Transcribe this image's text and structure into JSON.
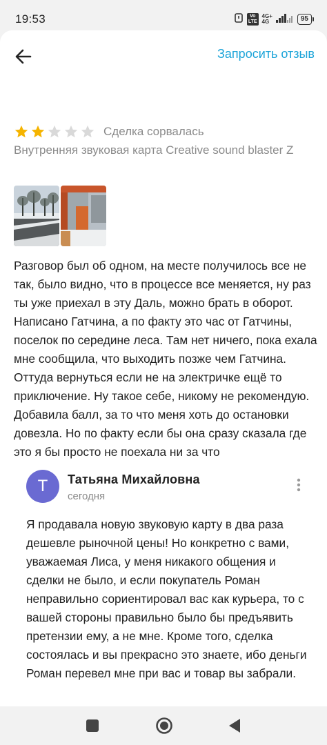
{
  "status_bar": {
    "time": "19:53",
    "volte": "Vo\nLTE",
    "network": "4G+\n4G",
    "battery": "95"
  },
  "app_bar": {
    "request_review_label": "Запросить отзыв"
  },
  "review": {
    "rating": 2,
    "max_rating": 5,
    "deal_status": "Сделка сорвалась",
    "item_title": "Внутренняя звуковая карта Creative sound blaster Z",
    "photos": [
      "photo-winter-road",
      "photo-bus-stop"
    ],
    "text": "Разговор был об одном, на месте получилось все не так, было видно, что в процессе все меняется, ну раз ты уже приехал в эту Даль, можно брать в оборот.\nНаписано Гатчина, а по факту это час от Гатчины, поселок по середине леса. Там нет ничего, пока ехала мне сообщила, что выходить позже чем Гатчина. Оттуда вернуться если не на электричке ещё то приключение. Ну такое себе, никому не рекомендую. Добавила балл, за то что меня хоть до остановки довезла. Но по факту если бы она сразу сказала где это я бы просто не поехала ни за что"
  },
  "reply": {
    "avatar_letter": "Т",
    "author": "Татьяна  Михайловна",
    "date": "сегодня",
    "text": "Я продавала новую звуковую карту в два раза дешевле рыночной цены! Но конкретно с вами, уважаемая Лиса, у меня никакого общения и сделки не было, и если покупатель Роман неправильно сориентировал вас как курьера, то с вашей стороны правильно было бы предъявить претензии ему, а не мне. Кроме того, сделка состоялась и вы прекрасно это знаете, ибо деньги Роман перевел мне при вас и товар вы забрали."
  },
  "colors": {
    "accent": "#1aa3d8",
    "star_filled": "#f5b400",
    "star_empty": "#d9d9d9",
    "avatar": "#6a6ad2"
  }
}
